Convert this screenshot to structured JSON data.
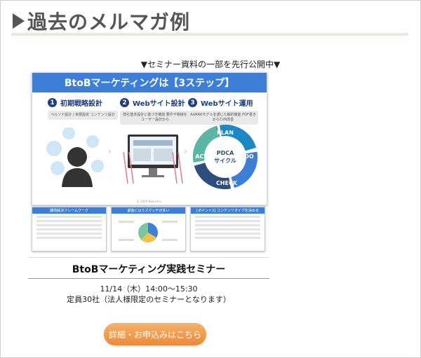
{
  "page": {
    "title": "過去のメルマガ例",
    "notice": "▼セミナー資料の一部を先行公開中▼"
  },
  "slide": {
    "header": "BtoBマーケティングは【3ステップ】",
    "steps": [
      {
        "num": "1",
        "name": "初期戦略設計",
        "desc": "ペルソナ設計 / 目標設定 コンテンツ設計"
      },
      {
        "num": "2",
        "name": "Webサイト設計",
        "desc": "弊社基本設計に基づき機能 要件や導線をユーザー設計から"
      },
      {
        "num": "3",
        "name": "Webサイト運用",
        "desc": "AARRRモデルを通じた解析機能 PDF書きからCVR改善"
      }
    ],
    "cycle": {
      "plan": "PLAN",
      "do": "DO",
      "check": "CHECK",
      "act": "ACT",
      "center_en": "PDCA",
      "center_ja": "サイクル"
    },
    "footer": "© 2019 Nexia Inc."
  },
  "thumbs": [
    {
      "title": "課題解決フレームワーク"
    },
    {
      "title": "顧客にはミスマッチが多い"
    },
    {
      "title": "[ポイント2] コンテンツタイプを決める"
    }
  ],
  "seminar": {
    "title": "BtoBマーケティング実践セミナー",
    "datetime": "11/14（木）14:00〜15:30",
    "capacity": "定員30社（法人様限定のセミナーとなります）",
    "cta_label": "詳細・お申込みはこちら"
  }
}
